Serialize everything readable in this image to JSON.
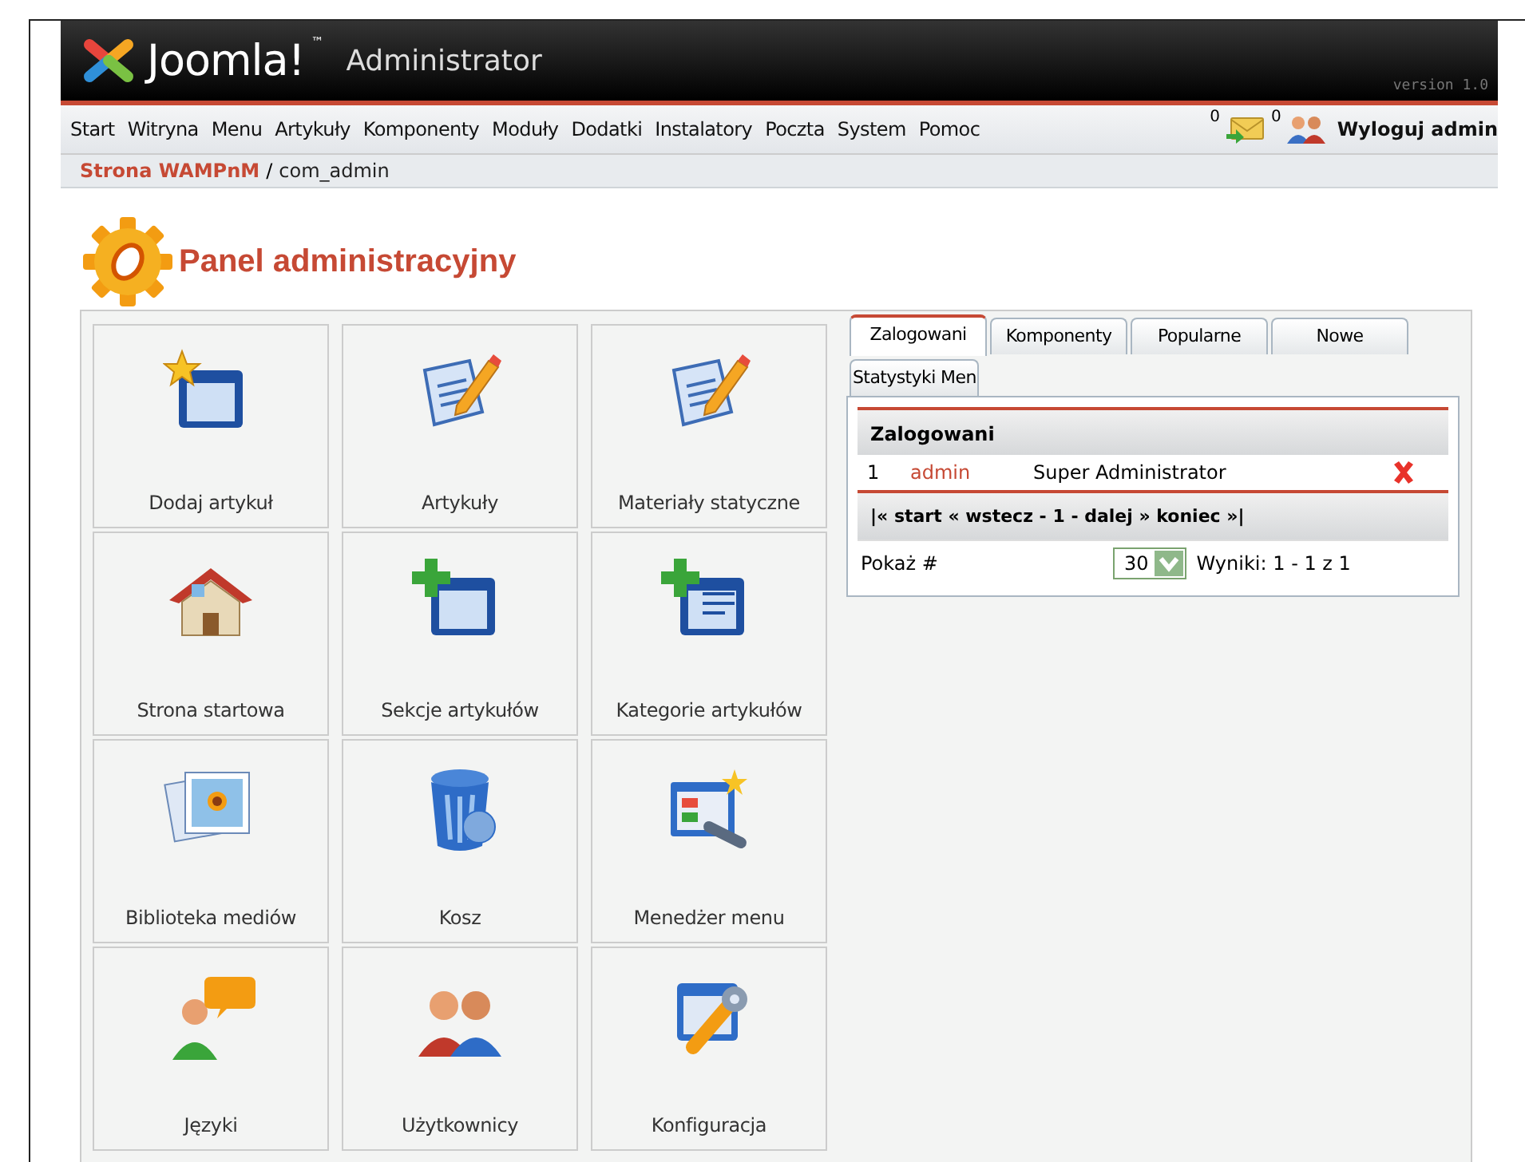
{
  "header": {
    "logo": "Joomla!",
    "logo_mark": "™",
    "subtitle": "Administrator",
    "version": "version 1.0"
  },
  "menu": {
    "items": [
      "Start",
      "Witryna",
      "Menu",
      "Artykuły",
      "Komponenty",
      "Moduły",
      "Dodatki",
      "Instalatory",
      "Poczta",
      "System",
      "Pomoc"
    ],
    "messages_count": "0",
    "users_count": "0",
    "logout": "Wyloguj admin"
  },
  "breadcrumb": {
    "site": "Strona WAMPnM",
    "separator": "/",
    "current": "com_admin"
  },
  "page_title": "Panel administracyjny",
  "tiles": [
    {
      "label": "Dodaj artykuł"
    },
    {
      "label": "Artykuły"
    },
    {
      "label": "Materiały statyczne"
    },
    {
      "label": "Strona startowa"
    },
    {
      "label": "Sekcje artykułów"
    },
    {
      "label": "Kategorie artykułów"
    },
    {
      "label": "Biblioteka mediów"
    },
    {
      "label": "Kosz"
    },
    {
      "label": "Menedżer menu"
    },
    {
      "label": "Języki"
    },
    {
      "label": "Użytkownicy"
    },
    {
      "label": "Konfiguracja"
    }
  ],
  "tabs": [
    {
      "label": "Zalogowani",
      "selected": true
    },
    {
      "label": "Komponenty",
      "selected": false
    },
    {
      "label": "Popularne",
      "selected": false
    },
    {
      "label": "Nowe",
      "selected": false
    },
    {
      "label": "Statystyki Men",
      "selected": false
    }
  ],
  "logged_table": {
    "title": "Zalogowani",
    "rows": [
      {
        "number": "1",
        "user": "admin",
        "group": "Super Administrator"
      }
    ],
    "pagination": "|« start « wstecz - 1 - dalej » koniec »|",
    "show_label": "Pokaż #",
    "show_value": "30",
    "results": "Wyniki: 1 - 1 z 1"
  }
}
